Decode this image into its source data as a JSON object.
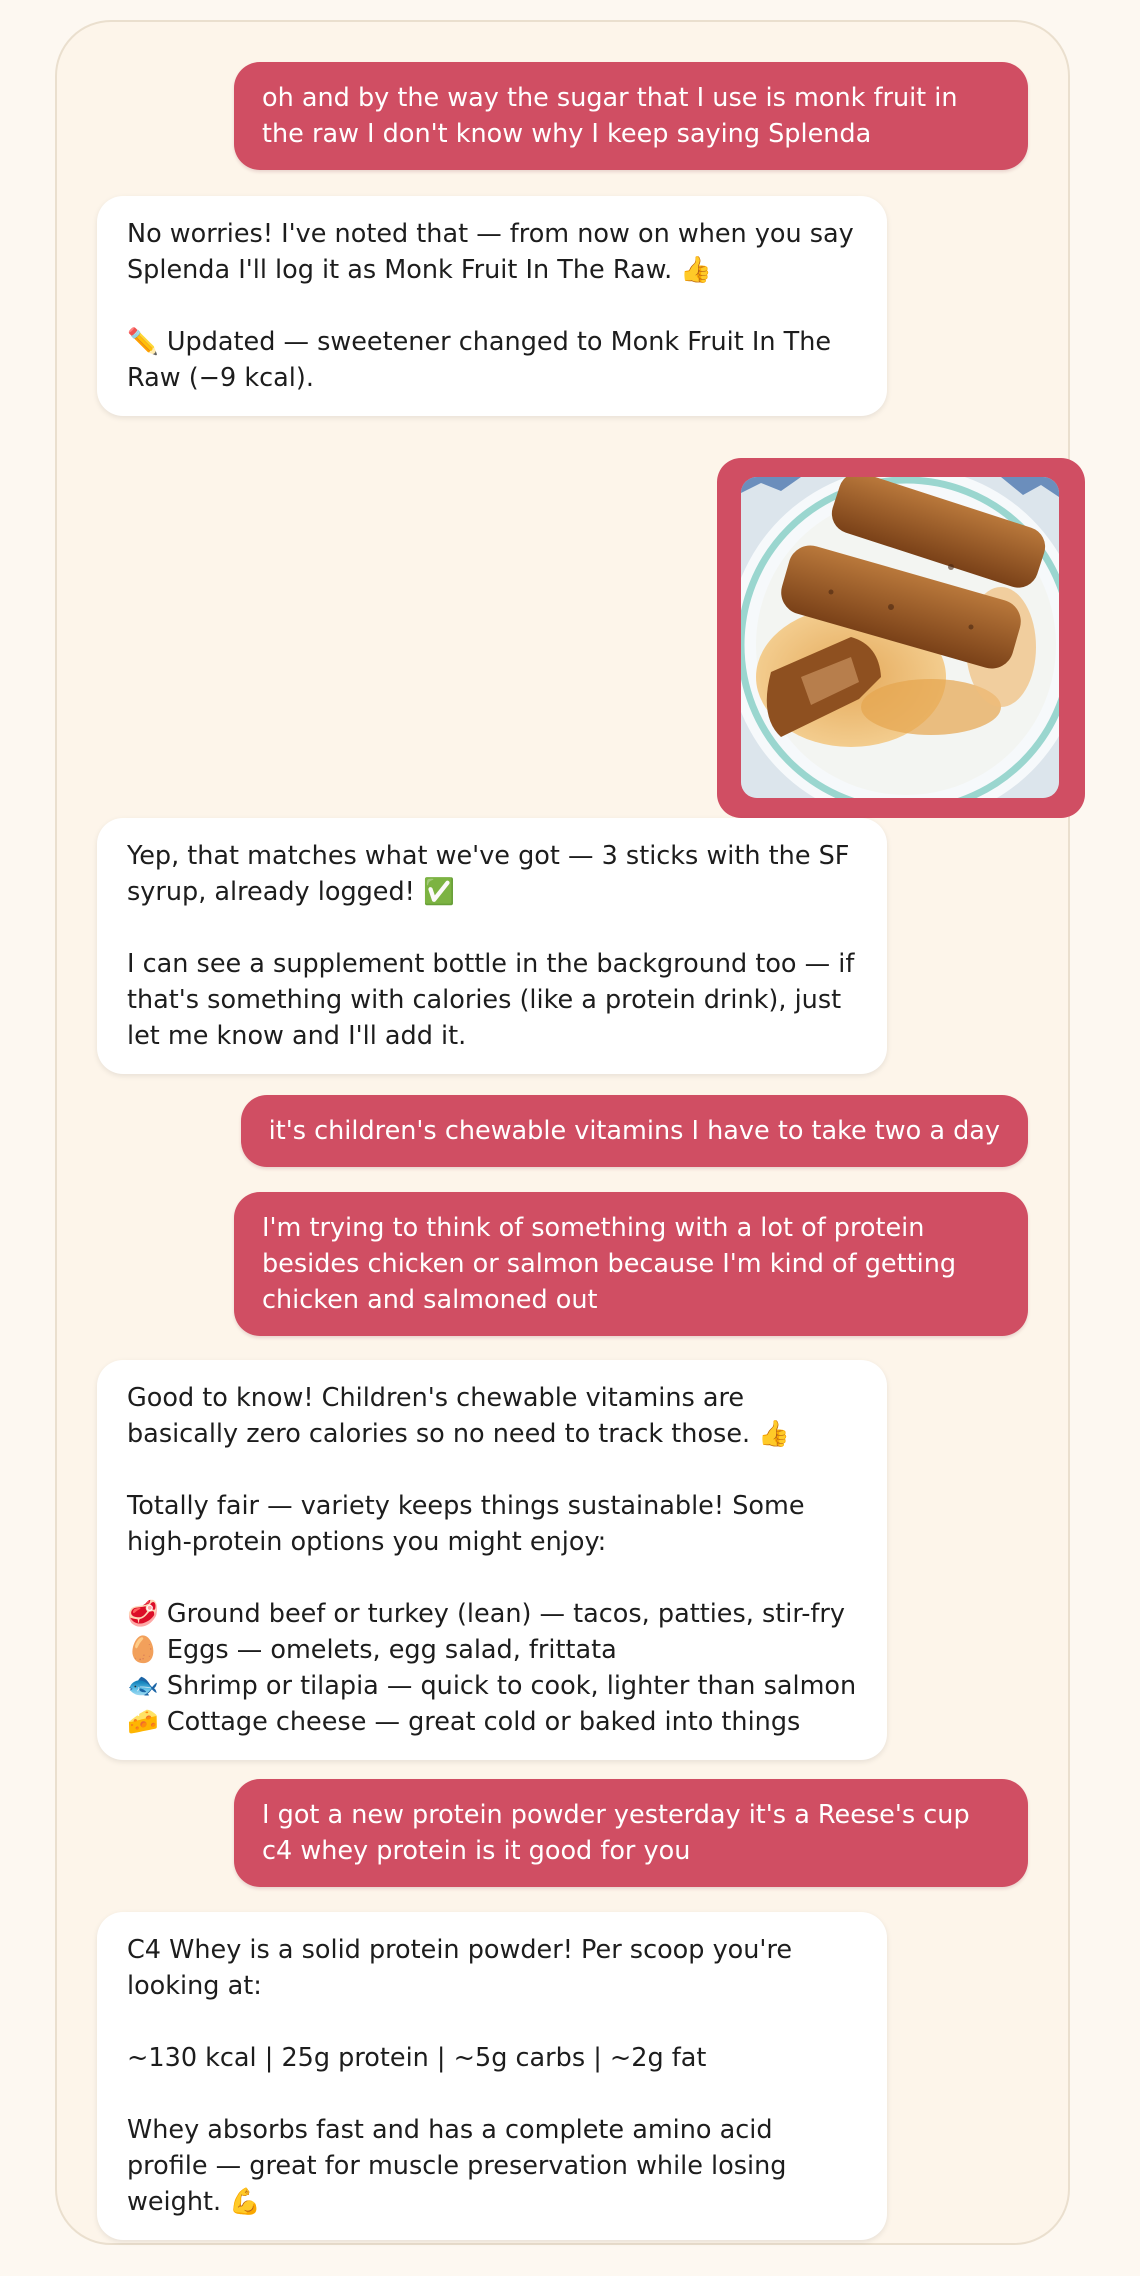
{
  "messages": [
    {
      "role": "user",
      "text": "oh and by the way the sugar that I use is monk fruit in the raw I don't know why I keep saying Splenda"
    },
    {
      "role": "assistant",
      "text": "No worries! I've noted that — from now on when you say Splenda I'll log it as Monk Fruit In The Raw. 👍\n\n✏️ Updated — sweetener changed to Monk Fruit In The Raw (−9 kcal)."
    },
    {
      "role": "user",
      "image": "french-toast-sticks-photo"
    },
    {
      "role": "assistant",
      "text": "Yep, that matches what we've got — 3 sticks with the SF syrup, already logged! ✅\n\nI can see a supplement bottle in the background too — if that's something with calories (like a protein drink), just let me know and I'll add it."
    },
    {
      "role": "user",
      "text": "it's children's chewable vitamins I have to take two a day"
    },
    {
      "role": "user",
      "text": "I'm trying to think of something with a lot of protein besides chicken or salmon because I'm kind of getting chicken and salmoned out"
    },
    {
      "role": "assistant",
      "text": "Good to know! Children's chewable vitamins are basically zero calories so no need to track those. 👍\n\nTotally fair — variety keeps things sustainable! Some high-protein options you might enjoy:\n\n🥩 Ground beef or turkey (lean) — tacos, patties, stir-fry\n🥚 Eggs — omelets, egg salad, frittata\n🐟 Shrimp or tilapia — quick to cook, lighter than salmon\n🧀 Cottage cheese — great cold or baked into things"
    },
    {
      "role": "user",
      "text": "I got a new protein powder yesterday it's a Reese's cup c4 whey protein is it good for you"
    },
    {
      "role": "assistant",
      "text": "C4 Whey is a solid protein powder! Per scoop you're looking at:\n\n~130 kcal | 25g protein | ~5g carbs | ~2g fat\n\nWhey absorbs fast and has a complete amino acid profile — great for muscle preservation while losing weight. 💪"
    }
  ],
  "colors": {
    "user_bubble": "#d04e63",
    "assistant_bubble": "#ffffff",
    "background": "#fdf5ea"
  }
}
